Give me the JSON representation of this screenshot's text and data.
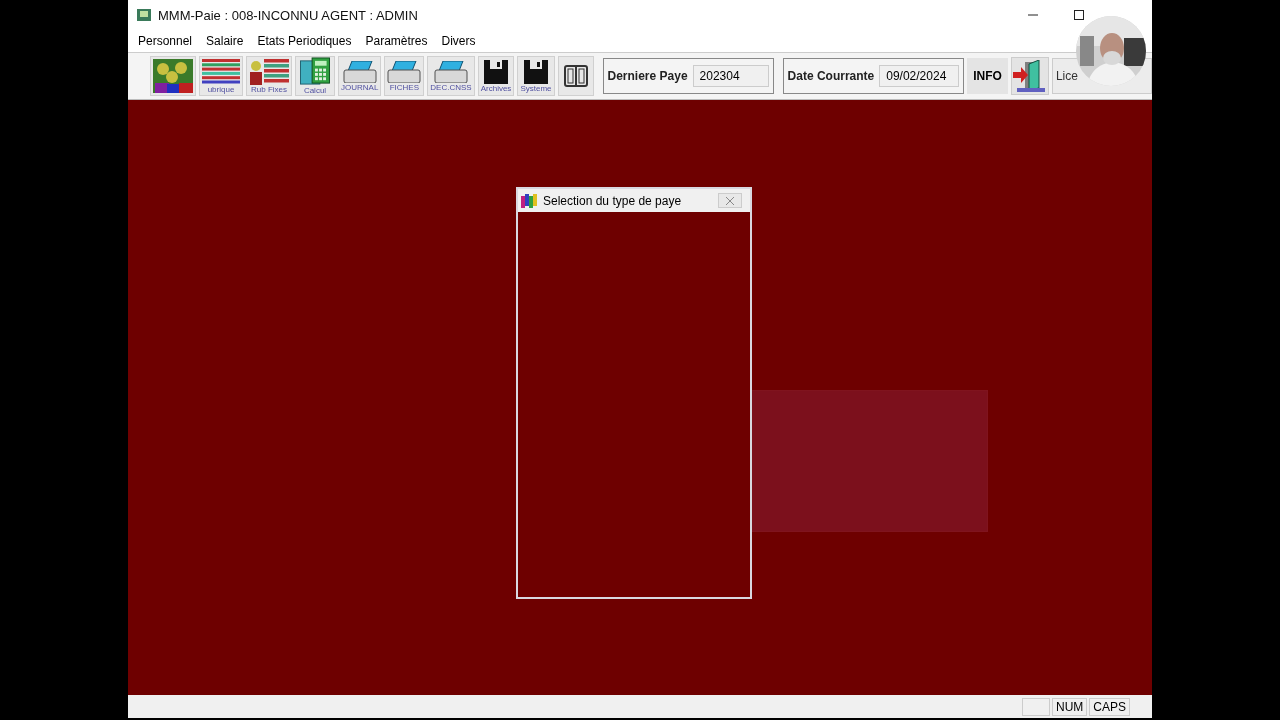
{
  "window": {
    "title": "MMM-Paie : 008-INCONNU AGENT : ADMIN"
  },
  "menu": [
    "Personnel",
    "Salaire",
    "Etats Periodiques",
    "Paramètres",
    "Divers"
  ],
  "toolbar": [
    {
      "kind": "people"
    },
    {
      "kind": "ledger",
      "caption": "ubrique"
    },
    {
      "kind": "person-ledger",
      "caption": "Rub Fixes"
    },
    {
      "kind": "calculator",
      "caption": "Calcul"
    },
    {
      "kind": "printer",
      "caption": "JOURNAL"
    },
    {
      "kind": "printer",
      "caption": "FICHES"
    },
    {
      "kind": "printer",
      "caption": "DEC.CNSS"
    },
    {
      "kind": "floppy",
      "caption": "Archives"
    },
    {
      "kind": "floppy",
      "caption": "Systeme"
    },
    {
      "kind": "panels"
    }
  ],
  "fields": [
    {
      "label": "Derniere Paye",
      "value": "202304"
    },
    {
      "label": "Date Courrante",
      "value": "09/02/2024"
    }
  ],
  "info_button": "INFO",
  "license_button": "Lice",
  "dialog": {
    "title": "Selection du type de paye"
  },
  "status_bar": {
    "indicators": [
      "NUM",
      "CAPS"
    ]
  }
}
